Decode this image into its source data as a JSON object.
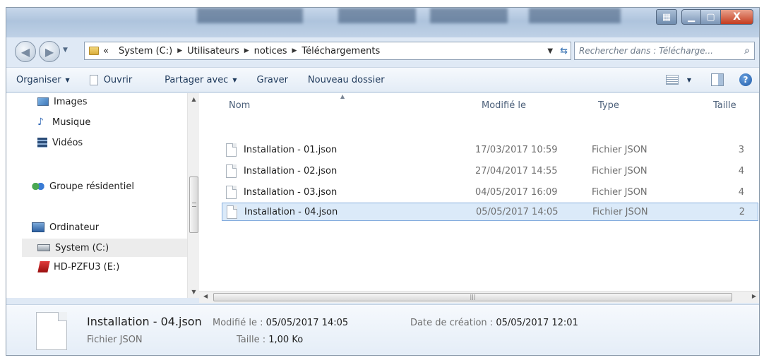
{
  "window": {
    "controls": {
      "close": "X"
    }
  },
  "address": {
    "overflow": "«",
    "path": [
      "System (C:)",
      "Utilisateurs",
      "notices",
      "Téléchargements"
    ]
  },
  "search": {
    "placeholder": "Rechercher dans : Télécharge..."
  },
  "toolbar": {
    "organize": "Organiser",
    "open": "Ouvrir",
    "share": "Partager avec",
    "burn": "Graver",
    "new_folder": "Nouveau dossier",
    "help": "?"
  },
  "nav": {
    "items": [
      {
        "label": "Images",
        "icon": "images-icon"
      },
      {
        "label": "Musique",
        "icon": "music-icon"
      },
      {
        "label": "Vidéos",
        "icon": "videos-icon"
      },
      {
        "label": "Groupe résidentiel",
        "icon": "homegroup-icon"
      },
      {
        "label": "Ordinateur",
        "icon": "computer-icon"
      },
      {
        "label": "System (C:)",
        "icon": "drive-icon",
        "selected": true
      },
      {
        "label": "HD-PZFU3 (E:)",
        "icon": "usb-drive-icon"
      }
    ]
  },
  "columns": {
    "name": "Nom",
    "modified": "Modifié le",
    "type": "Type",
    "size": "Taille"
  },
  "files": [
    {
      "name": "Installation - 01.json",
      "modified": "17/03/2017 10:59",
      "type": "Fichier JSON",
      "size": "3"
    },
    {
      "name": "Installation - 02.json",
      "modified": "27/04/2017 14:55",
      "type": "Fichier JSON",
      "size": "4"
    },
    {
      "name": "Installation - 03.json",
      "modified": "04/05/2017 16:09",
      "type": "Fichier JSON",
      "size": "4"
    },
    {
      "name": "Installation - 04.json",
      "modified": "05/05/2017 14:05",
      "type": "Fichier JSON",
      "size": "2",
      "selected": true
    }
  ],
  "details": {
    "name": "Installation - 04.json",
    "type": "Fichier JSON",
    "modified_label": "Modifié le :",
    "modified_value": "05/05/2017 14:05",
    "size_label": "Taille :",
    "size_value": "1,00 Ko",
    "created_label": "Date de création :",
    "created_value": "05/05/2017 12:01"
  },
  "colors": {
    "selection_bg": "#dbeaf9",
    "selection_border": "#84acdd",
    "close_red": "#c43c1f"
  }
}
